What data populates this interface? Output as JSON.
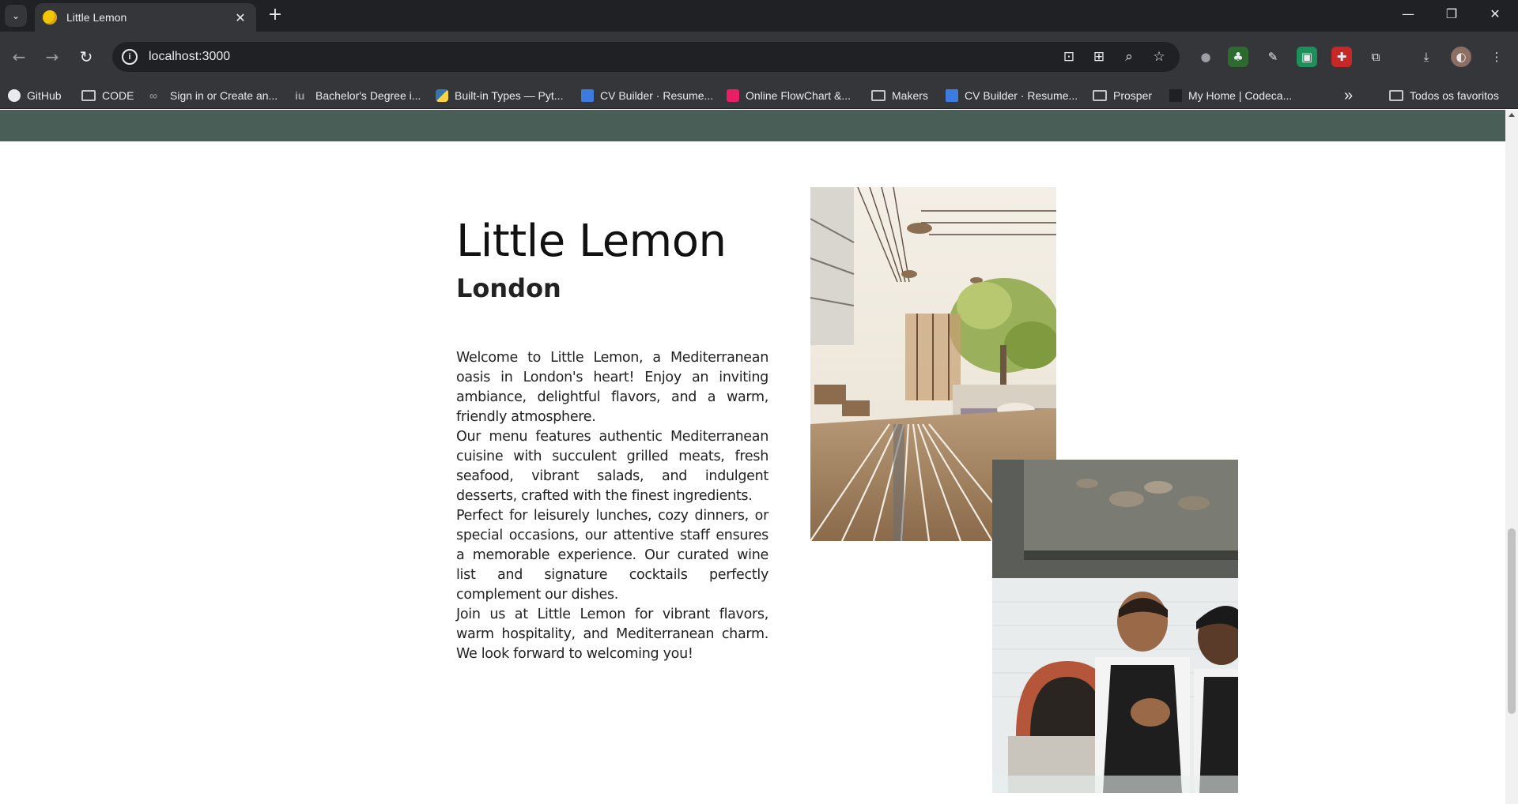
{
  "browser": {
    "tab_title": "Little Lemon",
    "new_tab": "+",
    "url": "localhost:3000",
    "tab_close": "✕",
    "window_controls": {
      "minimize": "—",
      "restore": "❐",
      "close": "✕"
    }
  },
  "bookmarks": [
    {
      "label": "GitHub",
      "icon": "github-icon"
    },
    {
      "label": "CODE",
      "icon": "folder-icon"
    },
    {
      "label": "Sign in or Create an...",
      "icon": "link-icon"
    },
    {
      "label": "Bachelor's Degree i...",
      "icon": "iu-icon"
    },
    {
      "label": "Built-in Types — Pyt...",
      "icon": "python-icon"
    },
    {
      "label": "CV Builder · Resume...",
      "icon": "cv-builder-icon"
    },
    {
      "label": "Online FlowChart &...",
      "icon": "flowchart-icon"
    },
    {
      "label": "Makers",
      "icon": "folder-icon"
    },
    {
      "label": "CV Builder · Resume...",
      "icon": "cv-builder-icon"
    },
    {
      "label": "Prosper",
      "icon": "folder-icon"
    },
    {
      "label": "My Home | Codeca...",
      "icon": "codecademy-icon"
    }
  ],
  "bookmarks_overflow": "»",
  "all_bookmarks": "Todos os favoritos",
  "page": {
    "title": "Little Lemon",
    "subtitle": "London",
    "paragraphs": [
      "Welcome to Little Lemon, a Mediterranean oasis in London's heart! Enjoy an inviting ambiance, delightful flavors, and a warm, friendly atmosphere.",
      "Our menu features authentic Mediterranean cuisine with succulent grilled meats, fresh seafood, vibrant salads, and indulgent desserts, crafted with the finest ingredients.",
      "Perfect for leisurely lunches, cozy dinners, or special occasions, our attentive staff ensures a memorable experience. Our curated wine list and signature cocktails perfectly complement our dishes.",
      "Join us at Little Lemon for vibrant flavors, warm hospitality, and Mediterranean charm. We look forward to welcoming you!"
    ],
    "images": [
      "restaurant-interior-photo",
      "chefs-photo"
    ]
  },
  "colors": {
    "header_strip": "#495e57",
    "chrome_dark": "#202124",
    "chrome_toolbar": "#35363a"
  }
}
